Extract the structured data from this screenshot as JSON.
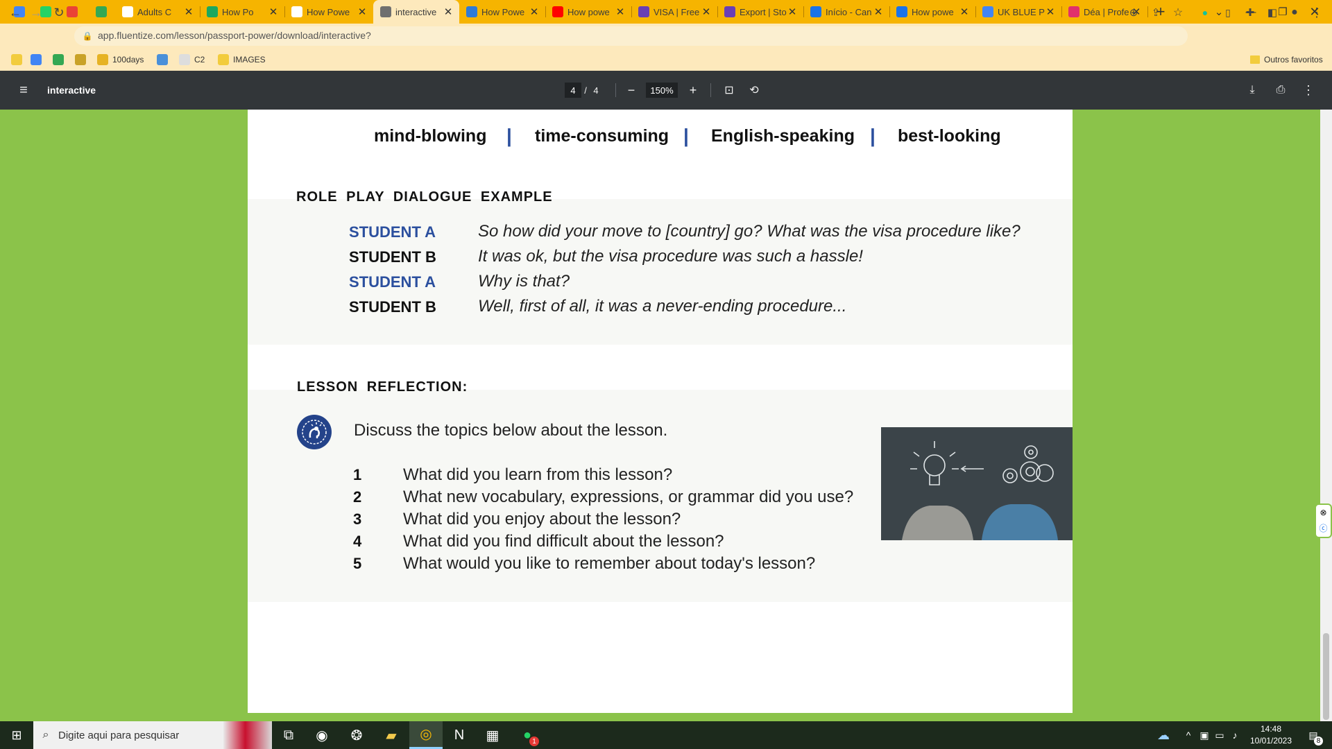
{
  "browser": {
    "tabs": [
      {
        "title": "",
        "favicon_color": "#4285f4",
        "pinned": true
      },
      {
        "title": "",
        "favicon_color": "#25d366",
        "pinned": true
      },
      {
        "title": "",
        "favicon_color": "#ea4335",
        "pinned": true
      },
      {
        "title": "",
        "favicon_color": "#34a853",
        "pinned": true
      },
      {
        "title": "Adults C",
        "favicon_color": "#ffffff",
        "pinned": false
      },
      {
        "title": "How Po",
        "favicon_color": "#1ca85f",
        "pinned": false
      },
      {
        "title": "How Powe",
        "favicon_color": "#ffffff",
        "pinned": false
      },
      {
        "title": "interactive",
        "favicon_color": "#6f6f6f",
        "pinned": false,
        "active": true
      },
      {
        "title": "How Powe",
        "favicon_color": "#2f7bd6",
        "pinned": false
      },
      {
        "title": "How powe",
        "favicon_color": "#ff0000",
        "pinned": false
      },
      {
        "title": "VISA | Free",
        "favicon_color": "#6a3fb5",
        "pinned": false
      },
      {
        "title": "Export | Sto",
        "favicon_color": "#6a3fb5",
        "pinned": false
      },
      {
        "title": "Início - Can",
        "favicon_color": "#1a73e8",
        "pinned": false
      },
      {
        "title": "How powe",
        "favicon_color": "#1a73e8",
        "pinned": false
      },
      {
        "title": "UK BLUE P",
        "favicon_color": "#4285f4",
        "pinned": false
      },
      {
        "title": "Déa | Profe",
        "favicon_color": "#e1306c",
        "pinned": false
      }
    ],
    "new_tab": "+",
    "url": "app.fluentize.com/lesson/passport-power/download/interactive?",
    "bookmarks": [
      {
        "label": "",
        "color": "#f2cc3d"
      },
      {
        "label": "",
        "color": "#4285f4"
      },
      {
        "label": "",
        "color": "#34a853"
      },
      {
        "label": "",
        "color": "#c9a227"
      },
      {
        "label": "100days",
        "color": "#e6b325"
      },
      {
        "label": "",
        "color": "#4a90d9"
      },
      {
        "label": "C2",
        "color": "#dddddd"
      },
      {
        "label": "IMAGES",
        "color": "#f2cc3d"
      }
    ],
    "other_bookmarks": "Outros favoritos"
  },
  "pdf": {
    "title": "interactive",
    "page_current": "4",
    "page_sep": "/",
    "page_total": "4",
    "zoom": "150%"
  },
  "content": {
    "words": [
      "mind-blowing",
      "time-consuming",
      "English-speaking",
      "best-looking"
    ],
    "word_separator": "|",
    "roleplay_heading": "ROLE PLAY DIALOGUE EXAMPLE",
    "dialogue": [
      {
        "speaker": "STUDENT A",
        "line": "So how did your move to [country] go? What was the visa procedure like?",
        "color": "#2b4f9e"
      },
      {
        "speaker": "STUDENT B",
        "line": "It was ok, but the visa procedure was such a hassle!",
        "color": "#111111"
      },
      {
        "speaker": "STUDENT A",
        "line": "Why is that?",
        "color": "#2b4f9e"
      },
      {
        "speaker": "STUDENT B",
        "line": "Well, first of all, it was a never-ending procedure...",
        "color": "#111111"
      }
    ],
    "reflection_heading": "LESSON REFLECTION:",
    "discuss_text": "Discuss the topics below about the lesson.",
    "questions": [
      {
        "num": "1",
        "text": "What did you learn from this lesson?"
      },
      {
        "num": "2",
        "text": "What new vocabulary, expressions, or grammar did you use?"
      },
      {
        "num": "3",
        "text": "What did you enjoy about the lesson?"
      },
      {
        "num": "4",
        "text": "What did you find difficult about the lesson?"
      },
      {
        "num": "5",
        "text": "What would you like to remember about today's lesson?"
      }
    ]
  },
  "taskbar": {
    "search_placeholder": "Digite aqui para pesquisar",
    "time": "14:48",
    "date": "10/01/2023",
    "notification_count": "8",
    "whatsapp_badge": "1"
  }
}
